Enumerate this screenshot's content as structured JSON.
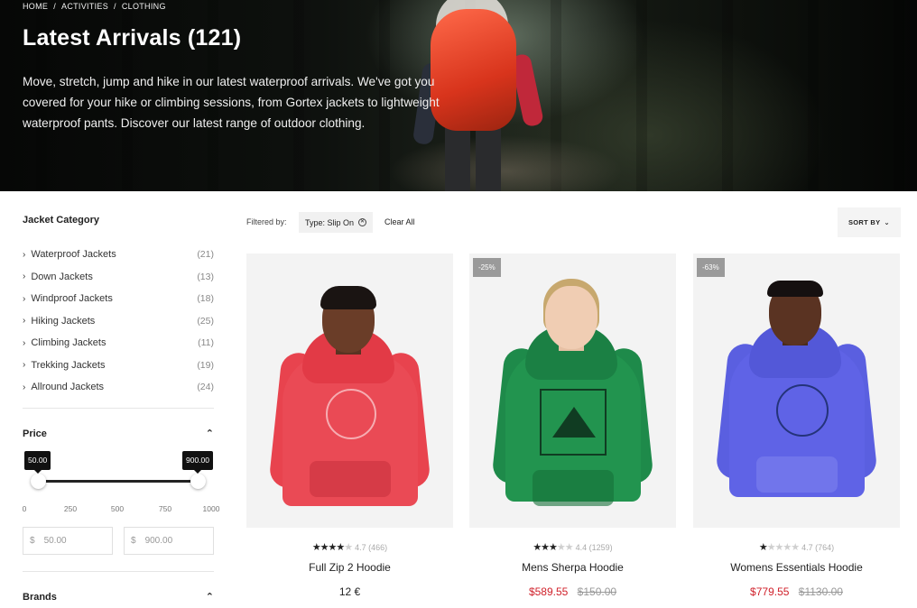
{
  "breadcrumb": [
    "HOME",
    "ACTIVITIES",
    "CLOTHING"
  ],
  "breadcrumb_sep": "/",
  "hero": {
    "title": "Latest Arrivals (121)",
    "description": "Move, stretch, jump and hike in our latest waterproof arrivals. We've got you covered for your hike or climbing sessions, from Gortex jackets to lightweight waterproof pants. Discover our latest range of outdoor clothing."
  },
  "sidebar": {
    "category_title": "Jacket Category",
    "categories": [
      {
        "label": "Waterproof Jackets",
        "count": "(21)"
      },
      {
        "label": "Down Jackets",
        "count": "(13)"
      },
      {
        "label": "Windproof Jackets",
        "count": "(18)"
      },
      {
        "label": "Hiking Jackets",
        "count": "(25)"
      },
      {
        "label": "Climbing Jackets",
        "count": "(11)"
      },
      {
        "label": "Trekking Jackets",
        "count": "(19)"
      },
      {
        "label": "Allround Jackets",
        "count": "(24)"
      }
    ],
    "price": {
      "title": "Price",
      "min_tip": "50.00",
      "max_tip": "900.00",
      "scale": [
        "0",
        "250",
        "500",
        "750",
        "1000"
      ],
      "currency": "$",
      "min_value": "50.00",
      "max_value": "900.00"
    },
    "brands_title": "Brands"
  },
  "toolbar": {
    "filtered_label": "Filtered by:",
    "chip_label": "Type: Slip On",
    "clear_label": "Clear All",
    "sort_label": "SORT BY"
  },
  "products": [
    {
      "name": "Full Zip 2 Hoodie",
      "rating_text": "4.7 (466)",
      "stars": 4.5,
      "price": "12 €",
      "sale": "",
      "old": "",
      "badge": "",
      "color": "#e8434e"
    },
    {
      "name": "Mens Sherpa Hoodie",
      "rating_text": "4.4 (1259)",
      "stars": 3,
      "price": "",
      "sale": "$589.55",
      "old": "$150.00",
      "badge": "-25%",
      "color": "#1e8a4a"
    },
    {
      "name": "Womens Essentials Hoodie",
      "rating_text": "4.7 (764)",
      "stars": 1,
      "price": "",
      "sale": "$779.55",
      "old": "$1130.00",
      "badge": "-63%",
      "color": "#5a5fe0"
    }
  ]
}
